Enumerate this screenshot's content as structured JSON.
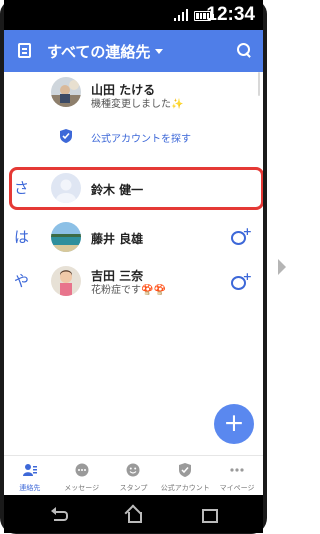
{
  "status_bar": {
    "time": "12:34"
  },
  "app_bar": {
    "title": "すべての連絡先"
  },
  "contacts": [
    {
      "name": "山田 たける",
      "status": "機種変更しました✨"
    },
    {
      "link": "公式アカウントを探す"
    },
    {
      "index": "さ",
      "name": "鈴木 健一"
    },
    {
      "index": "は",
      "name": "藤井 良雄"
    },
    {
      "index": "や",
      "name": "吉田 三奈",
      "status": "花粉症です🍄🍄"
    }
  ],
  "fab": {
    "label": "+"
  },
  "bottom_nav": [
    {
      "label": "連絡先",
      "active": true
    },
    {
      "label": "メッセージ"
    },
    {
      "label": "スタンプ"
    },
    {
      "label": "公式アカウント"
    },
    {
      "label": "マイページ"
    }
  ],
  "colors": {
    "accent": "#4f7ee8",
    "highlight": "#e53935",
    "fab": "#5a88ef"
  }
}
